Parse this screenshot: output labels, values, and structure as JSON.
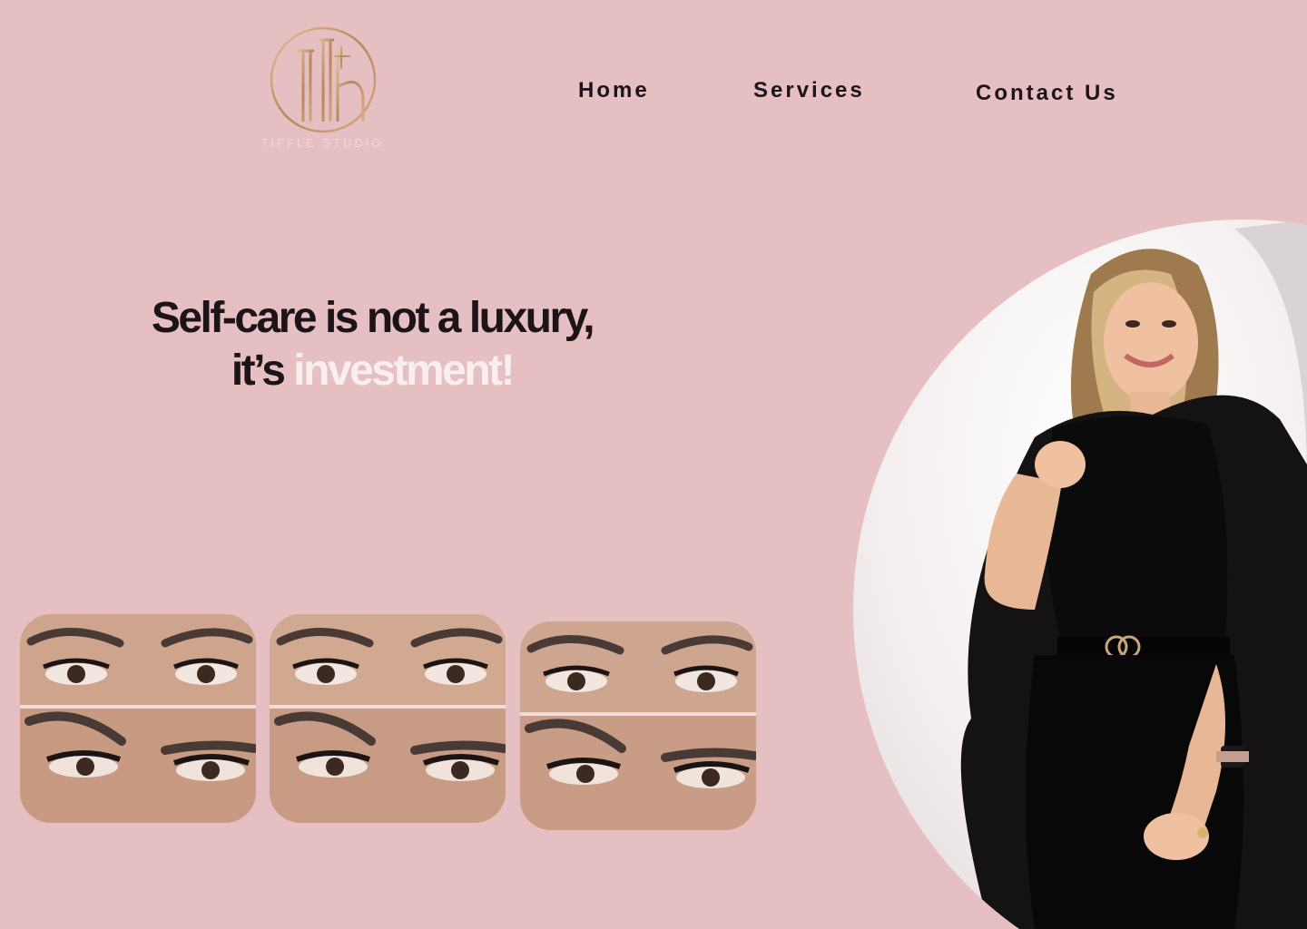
{
  "logo": {
    "text": "TIFFLE STUDIO",
    "alt": "logo-mark"
  },
  "nav": {
    "home": "Home",
    "services": "Services",
    "contact": "Contact Us"
  },
  "hero": {
    "line1": "Self-care is not a luxury,",
    "line2_prefix": "it’s ",
    "line2_accent": "investment!"
  },
  "gallery": {
    "items": [
      {
        "name": "brow-lash-result-1"
      },
      {
        "name": "brow-lash-result-2"
      },
      {
        "name": "brow-lash-result-3"
      }
    ]
  },
  "colors": {
    "background": "#e5bfc1",
    "text_dark": "#1d1418",
    "accent_text": "#fbeeee",
    "logo_gold": "#c79a6d"
  }
}
